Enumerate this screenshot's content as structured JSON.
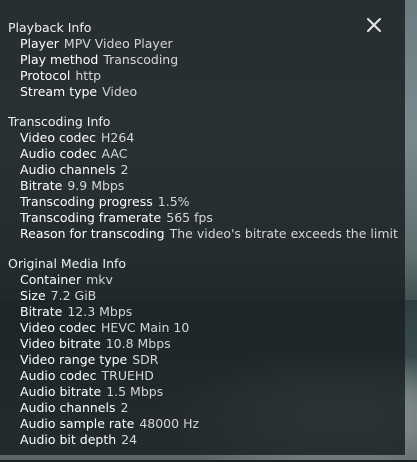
{
  "close_icon": "close-icon",
  "sections": [
    {
      "title": "Playback Info",
      "rows": [
        {
          "label": "Player",
          "value": "MPV Video Player"
        },
        {
          "label": "Play method",
          "value": "Transcoding"
        },
        {
          "label": "Protocol",
          "value": "http"
        },
        {
          "label": "Stream type",
          "value": "Video"
        }
      ]
    },
    {
      "title": "Transcoding Info",
      "rows": [
        {
          "label": "Video codec",
          "value": "H264"
        },
        {
          "label": "Audio codec",
          "value": "AAC"
        },
        {
          "label": "Audio channels",
          "value": "2"
        },
        {
          "label": "Bitrate",
          "value": "9.9 Mbps"
        },
        {
          "label": "Transcoding progress",
          "value": "1.5%"
        },
        {
          "label": "Transcoding framerate",
          "value": "565 fps"
        },
        {
          "label": "Reason for transcoding",
          "value": "The video's bitrate exceeds the limit"
        }
      ]
    },
    {
      "title": "Original Media Info",
      "rows": [
        {
          "label": "Container",
          "value": "mkv"
        },
        {
          "label": "Size",
          "value": "7.2 GiB"
        },
        {
          "label": "Bitrate",
          "value": "12.3 Mbps"
        },
        {
          "label": "Video codec",
          "value": "HEVC Main 10"
        },
        {
          "label": "Video bitrate",
          "value": "10.8 Mbps"
        },
        {
          "label": "Video range type",
          "value": "SDR"
        },
        {
          "label": "Audio codec",
          "value": "TRUEHD"
        },
        {
          "label": "Audio bitrate",
          "value": "1.5 Mbps"
        },
        {
          "label": "Audio channels",
          "value": "2"
        },
        {
          "label": "Audio sample rate",
          "value": "48000 Hz"
        },
        {
          "label": "Audio bit depth",
          "value": "24"
        }
      ]
    }
  ]
}
